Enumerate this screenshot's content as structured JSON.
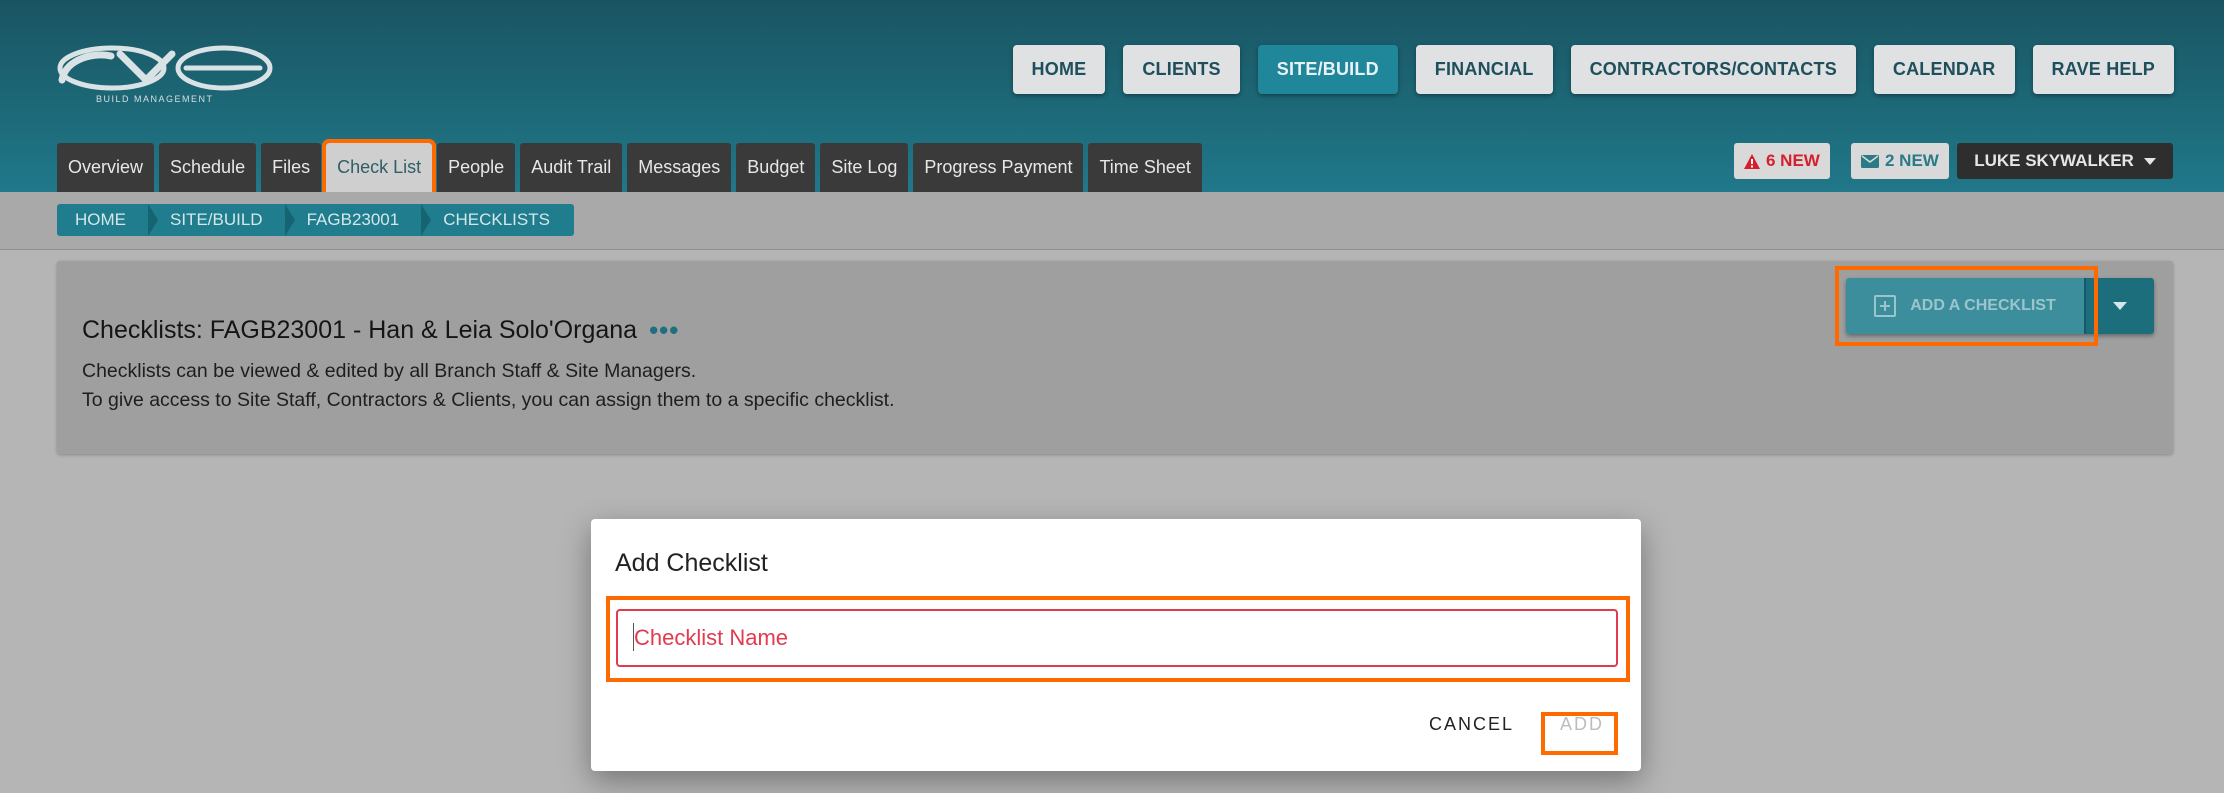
{
  "brand": {
    "subtitle": "BUILD MANAGEMENT"
  },
  "topnav": [
    "HOME",
    "CLIENTS",
    "SITE/BUILD",
    "FINANCIAL",
    "CONTRACTORS/CONTACTS",
    "CALENDAR",
    "RAVE HELP"
  ],
  "tabs": [
    "Overview",
    "Schedule",
    "Files",
    "Check List",
    "People",
    "Audit Trail",
    "Messages",
    "Budget",
    "Site Log",
    "Progress Payment",
    "Time Sheet"
  ],
  "notifications": {
    "alerts": "6 NEW",
    "messages": "2 NEW"
  },
  "user": {
    "name": "LUKE SKYWALKER"
  },
  "breadcrumb": [
    "HOME",
    "SITE/BUILD",
    "FAGB23001",
    "CHECKLISTS"
  ],
  "page": {
    "title": "Checklists: FAGB23001 - Han & Leia Solo'Organa",
    "more": "•••",
    "desc_line1": "Checklists can be viewed & edited by all Branch Staff & Site Managers.",
    "desc_line2": "To give access to Site Staff, Contractors & Clients, you can assign them to a specific checklist.",
    "add_button": "ADD A CHECKLIST"
  },
  "dialog": {
    "title": "Add Checklist",
    "input_placeholder": "Checklist Name",
    "input_value": "",
    "cancel": "CANCEL",
    "add": "ADD"
  },
  "colors": {
    "accent": "#1f8799",
    "highlight": "#ff6a00",
    "error": "#e23a4f"
  }
}
